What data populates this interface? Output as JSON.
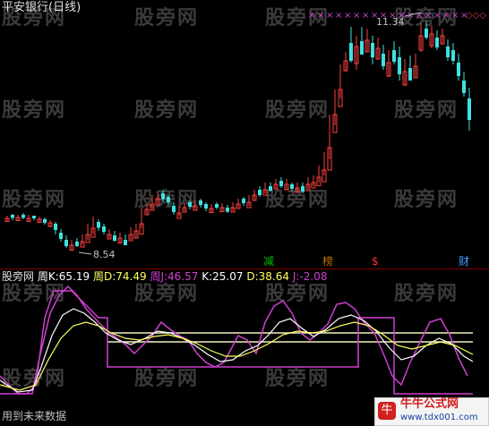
{
  "upper_panel": {
    "title": "平安银行(日线)",
    "high_label": "11.34",
    "low_label": "8.54",
    "signal_marks": [
      {
        "text": "减",
        "color": "#00c000"
      },
      {
        "text": "榜",
        "color": "#c07000"
      },
      {
        "text": "$",
        "color": "#ff3333"
      },
      {
        "text": "财",
        "color": "#40a0ff"
      }
    ]
  },
  "lower_panel": {
    "indicator_name": "股旁网",
    "fields": [
      {
        "label": "周K:",
        "value": "65.19",
        "color": "#ffffff"
      },
      {
        "label": "周D:",
        "value": "74.49",
        "color": "#ffff60"
      },
      {
        "label": "周J:",
        "value": "46.57",
        "color": "#d040d0"
      },
      {
        "label": "K:",
        "value": "25.07",
        "color": "#ffffff"
      },
      {
        "label": "D:",
        "value": "38.64",
        "color": "#ffff60"
      },
      {
        "label": "J:",
        "value": "-2.08",
        "color": "#d040d0"
      }
    ],
    "footer_note": "用到未来数据"
  },
  "watermark": "股旁网",
  "site_logo": {
    "title": "牛牛公式网",
    "url": "www.tdx001.com"
  },
  "colors": {
    "up": "#ff4040",
    "down": "#40e0e0",
    "k_line": "#ffffff",
    "d_line": "#ffff60",
    "j_line": "#d040d0",
    "week_d": "#f0f0c0"
  }
}
